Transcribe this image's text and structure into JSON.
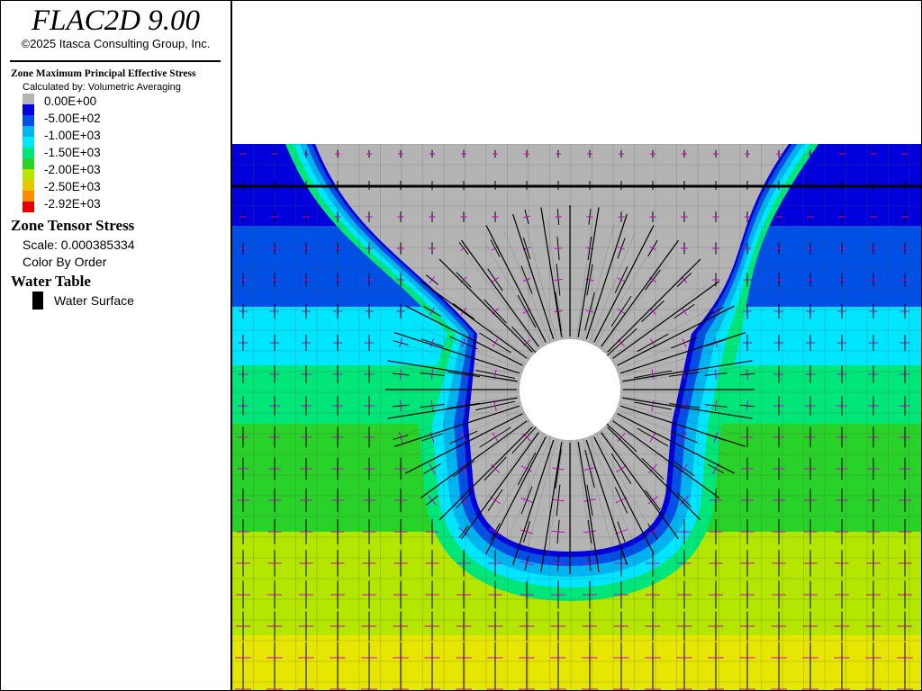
{
  "app": {
    "title": "FLAC2D 9.00",
    "copyright": "©2025 Itasca Consulting Group, Inc."
  },
  "legend": {
    "contour": {
      "title": "Zone Maximum Principal Effective Stress",
      "subtitle": "Calculated by: Volumetric Averaging",
      "levels": [
        {
          "label": "0.00E+00",
          "color": "#b4b4b4"
        },
        {
          "label": "-5.00E+02",
          "color": "#0050e6"
        },
        {
          "label": "-1.00E+03",
          "color": "#00b4f0"
        },
        {
          "label": "-1.50E+03",
          "color": "#00e678"
        },
        {
          "label": "-2.00E+03",
          "color": "#28d228"
        },
        {
          "label": "-2.50E+03",
          "color": "#e6c800"
        },
        {
          "label": "-2.92E+03",
          "color": "#e60000"
        }
      ],
      "extra_swatch_colors": [
        "#0000dc",
        "#00e6ff",
        "#b4e600",
        "#ff8c00"
      ]
    },
    "tensor": {
      "title": "Zone Tensor Stress",
      "scale": "Scale: 0.000385334",
      "color_mode": "Color By Order"
    },
    "water": {
      "title": "Water Table",
      "item": "Water Surface"
    }
  },
  "colors": {
    "gray_zone": "#b4b4b4",
    "band_1": "#0000dc",
    "band_2": "#0050e6",
    "band_3": "#00b4f0",
    "band_4": "#00e6ff",
    "band_5": "#00e678",
    "band_6": "#28d228",
    "band_7": "#b4e600",
    "band_8": "#e6e600",
    "tensor_major": "#000000",
    "tensor_minor": "#c800c8",
    "water_line": "#000000"
  }
}
